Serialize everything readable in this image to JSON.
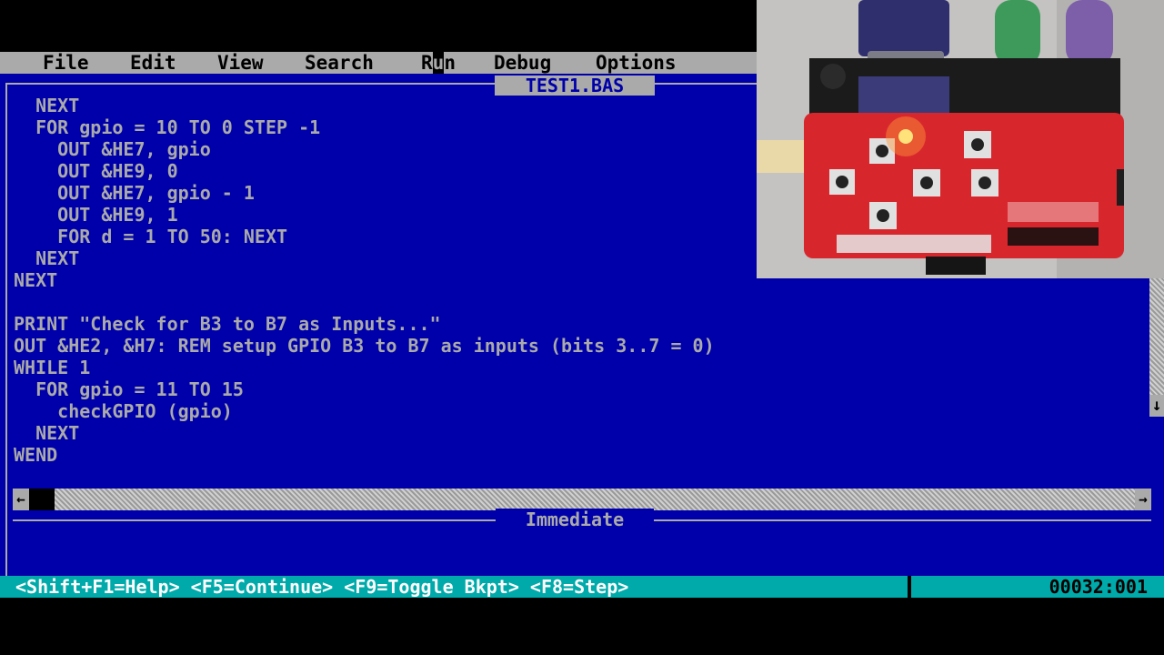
{
  "menu": [
    {
      "label": "File"
    },
    {
      "label": "Edit"
    },
    {
      "label": "View"
    },
    {
      "label": "Search"
    },
    {
      "label": "Run"
    },
    {
      "label": "Debug"
    },
    {
      "label": "Options"
    }
  ],
  "editor": {
    "file_name": "TEST1.BAS",
    "lines": [
      "  NEXT",
      "  FOR gpio = 10 TO 0 STEP -1",
      "    OUT &HE7, gpio",
      "    OUT &HE9, 0",
      "    OUT &HE7, gpio - 1",
      "    OUT &HE9, 1",
      "    FOR d = 1 TO 50: NEXT",
      "  NEXT",
      "NEXT",
      "",
      "PRINT \"Check for B3 to B7 as Inputs...\"",
      "OUT &HE2, &H7: REM setup GPIO B3 to B7 as inputs (bits 3..7 = 0)",
      "WHILE 1",
      "  FOR gpio = 11 TO 15",
      "    checkGPIO (gpio)",
      "  NEXT",
      "WEND"
    ]
  },
  "immediate": {
    "title": "Immediate",
    "content": ""
  },
  "status": {
    "help": "<Shift+F1=Help> <F5=Continue> <F9=Toggle Bkpt> <F8=Step>",
    "position": "00032:001"
  },
  "icons": {
    "scroll_left": "left-arrow-icon",
    "scroll_right": "right-arrow-icon",
    "scroll_down": "down-arrow-icon"
  },
  "colors": {
    "editor_bg": "#0000aa",
    "text": "#aaaaaa",
    "menubar_bg": "#aaaaaa",
    "statusbar_bg": "#00aaaa"
  }
}
